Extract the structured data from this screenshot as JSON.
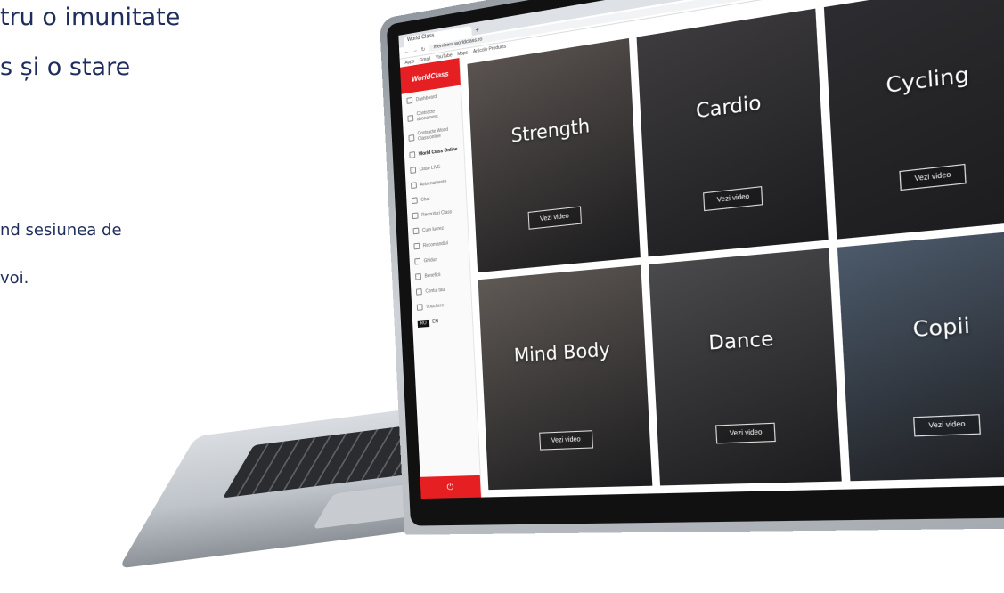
{
  "text": {
    "line1": "tru o imunitate",
    "line2": "s și o stare",
    "line3": "nd sesiunea de",
    "line4": "voi."
  },
  "browser": {
    "tab_title": "World Class",
    "url": "members.worldclass.ro",
    "bookmarks": [
      "Apps",
      "Gmail",
      "YouTube",
      "Maps",
      "Articole Products"
    ]
  },
  "app": {
    "logo": "WorldClass",
    "sidebar_items": [
      "Dashboard",
      "Contracte abonament",
      "Contracte World Class online",
      "World Class Online",
      "Clase LIVE",
      "Antrenamente",
      "Chat",
      "Recorduri Class",
      "Cum lucrez",
      "Recomandări",
      "Ghiduri",
      "Beneficii",
      "Contul tău",
      "Vouchere"
    ],
    "active_index": 3,
    "lang": [
      "RO",
      "EN"
    ],
    "power_glyph": "⏻"
  },
  "tiles": [
    {
      "label": "Strength",
      "button": "Vezi video",
      "color": "#5a5350"
    },
    {
      "label": "Cardio",
      "button": "Vezi video",
      "color": "#3d3b3d"
    },
    {
      "label": "Cycling",
      "button": "Vezi video",
      "color": "#2d2c30"
    },
    {
      "label": "Mind Body",
      "button": "Vezi video",
      "color": "#5f5955"
    },
    {
      "label": "Dance",
      "button": "Vezi video",
      "color": "#4a4a4c"
    },
    {
      "label": "Copii",
      "button": "Vezi video",
      "color": "#4c5a6b"
    }
  ],
  "colors": {
    "brand": "#e51f22",
    "copy": "#1f2d5c"
  }
}
